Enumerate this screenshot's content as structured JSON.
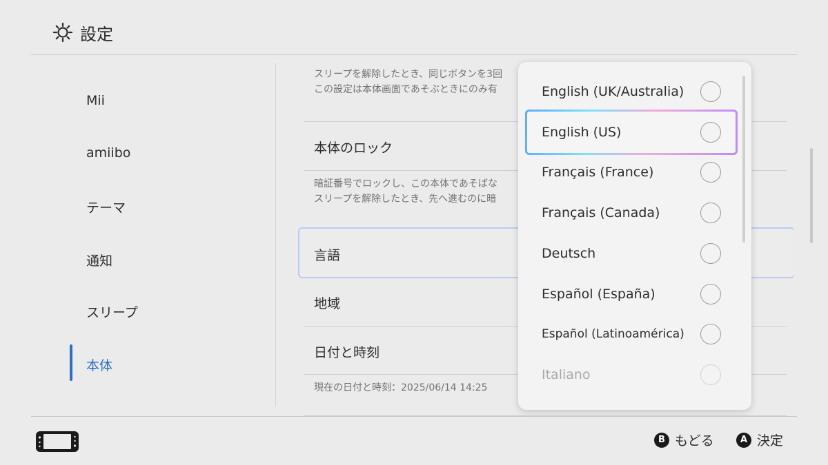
{
  "header": {
    "title": "設定",
    "icon": "gear-icon"
  },
  "sidebar": {
    "items": [
      {
        "label": "Mii"
      },
      {
        "label": "amiibo"
      },
      {
        "label": "テーマ"
      },
      {
        "label": "通知"
      },
      {
        "label": "スリープ"
      },
      {
        "label": "本体"
      }
    ],
    "active_index": 5
  },
  "content": {
    "desc_top": [
      "スリープを解除したとき、同じボタンを3回",
      "この設定は本体画面であそぶときにのみ有"
    ],
    "lock_label": "本体のロック",
    "lock_desc": [
      "暗証番号でロックし、この本体であそばな",
      "スリープを解除したとき、先へ進むのに暗"
    ],
    "language_label": "言語",
    "region_label": "地域",
    "datetime_label": "日付と時刻",
    "datetime_desc": "現在の日付と時刻：2025/06/14 14:25"
  },
  "language_popup": {
    "options": [
      {
        "label": "English (UK/Australia)"
      },
      {
        "label": "English (US)"
      },
      {
        "label": "Français (France)"
      },
      {
        "label": "Français (Canada)"
      },
      {
        "label": "Deutsch"
      },
      {
        "label": "Español (España)"
      },
      {
        "label": "Español (Latinoamérica)"
      },
      {
        "label": "Italiano"
      }
    ],
    "focused_index": 1
  },
  "footer": {
    "back_button": "B",
    "back_label": "もどる",
    "confirm_button": "A",
    "confirm_label": "決定"
  },
  "colors": {
    "accent": "#2a6fc9",
    "background": "#ebebeb",
    "popup": "#f3f3f3"
  }
}
